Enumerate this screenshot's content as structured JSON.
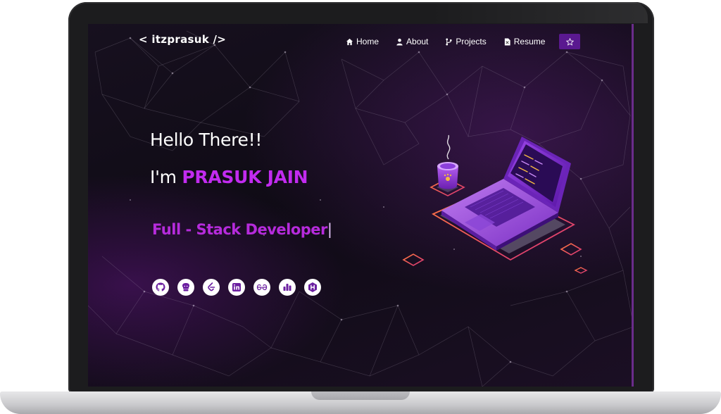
{
  "brand": "< itzprasuk />",
  "nav": {
    "items": [
      {
        "label": "Home",
        "icon": "home-icon"
      },
      {
        "label": "About",
        "icon": "user-icon"
      },
      {
        "label": "Projects",
        "icon": "branch-icon"
      },
      {
        "label": "Resume",
        "icon": "file-icon"
      }
    ],
    "theme_toggle_icon": "star-icon"
  },
  "hero": {
    "greeting": "Hello There!!",
    "intro_prefix": "I'm ",
    "name": "PRASUK JAIN",
    "role": "Full - Stack Developer",
    "cursor": "|"
  },
  "social": [
    "github-icon",
    "codechef-icon",
    "leetcode-icon",
    "linkedin-icon",
    "geeksforgeeks-icon",
    "codeforces-icon",
    "hackerrank-icon"
  ],
  "colors": {
    "accent": "#c22bf0",
    "role": "#b62bdc",
    "theme_button": "#5a1990",
    "background": "#120d18"
  }
}
